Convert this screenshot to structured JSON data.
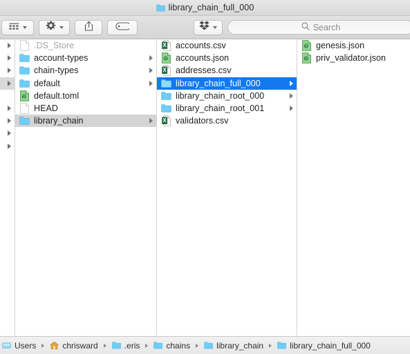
{
  "window": {
    "title": "library_chain_full_000",
    "title_icon": "folder-icon"
  },
  "toolbar": {
    "view_mode_button": {
      "icon": "column-view-icon",
      "chevron": "chevron-down-icon"
    },
    "action_button": {
      "icon": "gear-icon",
      "chevron": "chevron-down-icon"
    },
    "share_button": {
      "icon": "share-icon"
    },
    "tags_button": {
      "icon": "tag-icon"
    },
    "dropbox_button": {
      "icon": "dropbox-icon",
      "chevron": "chevron-down-icon"
    },
    "search": {
      "icon": "search-icon",
      "placeholder": "Search",
      "value": ""
    }
  },
  "columns": [
    {
      "name": "column-1",
      "items": [
        {
          "label": ".DS_Store",
          "icon": "generic-document-icon",
          "kind": "file",
          "dim": true,
          "has_arrow": false,
          "gutter_arrow": true,
          "selection": "none"
        },
        {
          "label": "account-types",
          "icon": "folder-icon",
          "kind": "folder",
          "dim": false,
          "has_arrow": true,
          "gutter_arrow": true,
          "selection": "none"
        },
        {
          "label": "chain-types",
          "icon": "folder-icon",
          "kind": "folder",
          "dim": false,
          "has_arrow": true,
          "gutter_arrow": true,
          "selection": "none"
        },
        {
          "label": "default",
          "icon": "folder-icon",
          "kind": "folder",
          "dim": false,
          "has_arrow": true,
          "gutter_arrow": true,
          "selection": "gutter"
        },
        {
          "label": "default.toml",
          "icon": "json-document-icon",
          "kind": "file",
          "dim": false,
          "has_arrow": false,
          "gutter_arrow": false,
          "selection": "none"
        },
        {
          "label": "HEAD",
          "icon": "generic-document-icon",
          "kind": "file",
          "dim": false,
          "has_arrow": false,
          "gutter_arrow": true,
          "selection": "none"
        },
        {
          "label": "library_chain",
          "icon": "folder-icon",
          "kind": "folder",
          "dim": false,
          "has_arrow": true,
          "gutter_arrow": true,
          "selection": "inactive"
        },
        {
          "label": "",
          "icon": "none",
          "kind": "blank",
          "dim": false,
          "has_arrow": false,
          "gutter_arrow": true,
          "selection": "none"
        },
        {
          "label": "",
          "icon": "none",
          "kind": "blank",
          "dim": false,
          "has_arrow": false,
          "gutter_arrow": true,
          "selection": "none"
        }
      ]
    },
    {
      "name": "column-2",
      "items": [
        {
          "label": "accounts.csv",
          "icon": "csv-document-icon",
          "kind": "file",
          "has_arrow": false,
          "selection": "none"
        },
        {
          "label": "accounts.json",
          "icon": "json-document-icon",
          "kind": "file",
          "has_arrow": false,
          "selection": "none"
        },
        {
          "label": "addresses.csv",
          "icon": "csv-document-icon",
          "kind": "file",
          "has_arrow": false,
          "selection": "none"
        },
        {
          "label": "library_chain_full_000",
          "icon": "folder-icon",
          "kind": "folder",
          "has_arrow": true,
          "selection": "active"
        },
        {
          "label": "library_chain_root_000",
          "icon": "folder-icon",
          "kind": "folder",
          "has_arrow": true,
          "selection": "none"
        },
        {
          "label": "library_chain_root_001",
          "icon": "folder-icon",
          "kind": "folder",
          "has_arrow": true,
          "selection": "none"
        },
        {
          "label": "validators.csv",
          "icon": "csv-document-icon",
          "kind": "file",
          "has_arrow": false,
          "selection": "none"
        }
      ]
    },
    {
      "name": "column-3",
      "items": [
        {
          "label": "genesis.json",
          "icon": "json-document-icon",
          "kind": "file",
          "has_arrow": false,
          "selection": "none"
        },
        {
          "label": "priv_validator.json",
          "icon": "json-document-icon",
          "kind": "file",
          "has_arrow": false,
          "selection": "none"
        }
      ]
    }
  ],
  "pathbar": {
    "crumbs": [
      {
        "label": "Users",
        "icon": "drive-icon"
      },
      {
        "label": "chrisward",
        "icon": "home-icon"
      },
      {
        "label": ".eris",
        "icon": "folder-icon"
      },
      {
        "label": "chains",
        "icon": "folder-icon"
      },
      {
        "label": "library_chain",
        "icon": "folder-icon"
      },
      {
        "label": "library_chain_full_000",
        "icon": "folder-icon"
      }
    ],
    "separator": "chevron-right-icon"
  },
  "colors": {
    "selection_blue": "#1478f0",
    "selection_gray": "#d4d4d4",
    "folder_blue": "#6fcdf5",
    "json_green": "#5cb85c",
    "csv_green": "#2f8a4e",
    "home_orange": "#e8a33d"
  }
}
